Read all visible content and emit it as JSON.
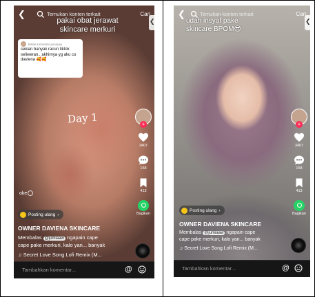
{
  "left_video": {
    "search_text": "Temukan konten terkait",
    "search_button": "Cari",
    "caption": "pakai obat jerawat skincare merkuri",
    "comment_bubble": {
      "title": "Balas komentar jumiaaw",
      "text": "sekian banyak racun tiktok seliweran.. akhirnya yg aku co daviena 🥰🥰"
    },
    "overlay_text": "Day 1",
    "likes": "3407",
    "comments": "158",
    "saves": "413",
    "share_label": "Bagikan",
    "oke_text": "oke",
    "repost_label": "Posting ulang",
    "author": "OWNER DAVIENA SKINCARE",
    "description_prefix": "Membalas",
    "mention": "@jumiaaw",
    "description_line1": "ngapain cape",
    "description_line2": "cape pake merkuri, kalo yan... banyak",
    "music": "Secret Love Song Lofi Remix (M...",
    "comment_placeholder": "Tambahkan komentar..."
  },
  "right_video": {
    "search_text": "Temukan konten terkait",
    "search_button": "Cari",
    "caption": "udah insyaf pake skincare BPOM😎",
    "likes": "3407",
    "comments": "158",
    "saves": "413",
    "share_label": "Bagikan",
    "repost_label": "Posting ulang",
    "author": "OWNER DAVIENA SKINCARE",
    "description_prefix": "Membalas",
    "mention": "@jumiaaw",
    "description_line1": "ngapain cape",
    "description_line2": "cape pake merkuri, kalo yan... banyak",
    "music": "Secret Love Song Lofi Remix (M...",
    "comment_placeholder": "Tambahkan komentar..."
  },
  "colors": {
    "like_red": "#fe2c55",
    "share_green": "#25d366",
    "repost_yellow": "#f5c518",
    "bottom_bar": "#161616"
  }
}
